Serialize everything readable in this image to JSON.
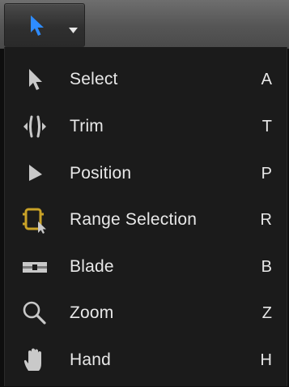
{
  "toolbar": {
    "current_tool_icon": "select-arrow-icon",
    "dropdown_icon": "chevron-down-icon",
    "accent_color": "#2e8cff"
  },
  "menu": {
    "items": [
      {
        "label": "Select",
        "shortcut": "A",
        "icon": "select-arrow-icon"
      },
      {
        "label": "Trim",
        "shortcut": "T",
        "icon": "trim-icon"
      },
      {
        "label": "Position",
        "shortcut": "P",
        "icon": "position-arrow-icon"
      },
      {
        "label": "Range Selection",
        "shortcut": "R",
        "icon": "range-selection-icon",
        "icon_color": "#c9a227"
      },
      {
        "label": "Blade",
        "shortcut": "B",
        "icon": "blade-icon"
      },
      {
        "label": "Zoom",
        "shortcut": "Z",
        "icon": "magnifier-icon"
      },
      {
        "label": "Hand",
        "shortcut": "H",
        "icon": "hand-icon"
      }
    ]
  }
}
